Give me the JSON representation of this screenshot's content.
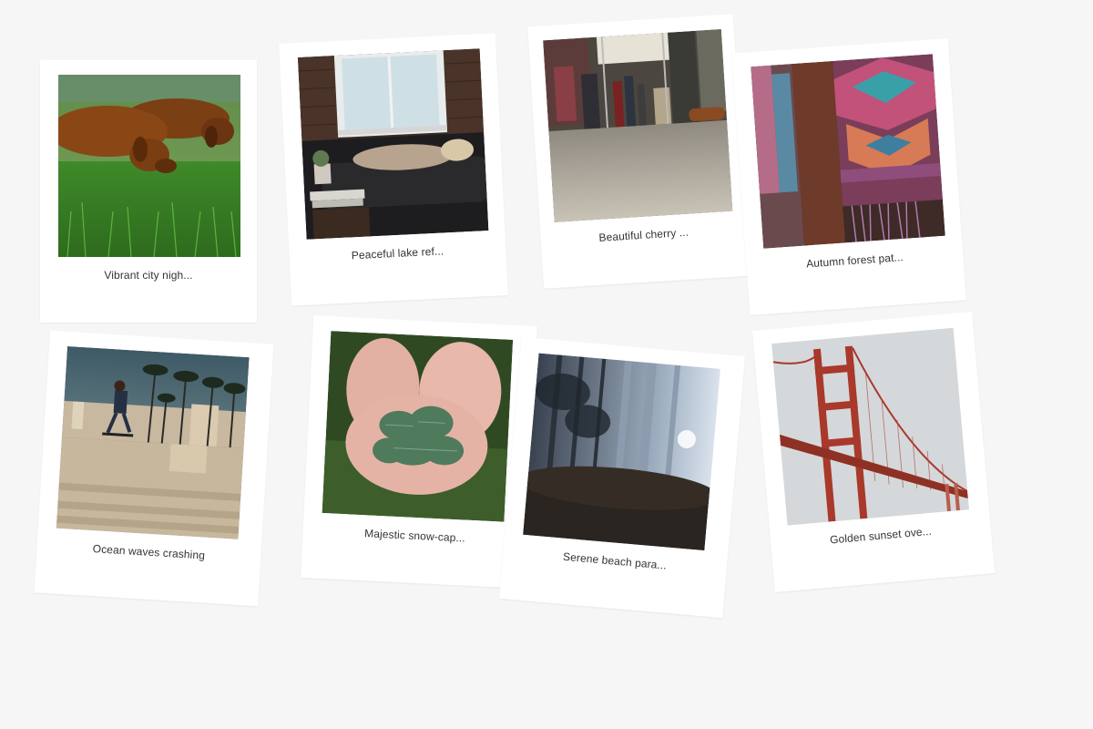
{
  "gallery": {
    "cards": [
      {
        "caption": "Vibrant city nigh...",
        "image": "dachshunds-on-grass"
      },
      {
        "caption": "Peaceful lake ref...",
        "image": "person-resting-on-sofa-by-window"
      },
      {
        "caption": "Beautiful cherry ...",
        "image": "subway-car-floor"
      },
      {
        "caption": "Autumn forest pat...",
        "image": "colorful-knit-shawl"
      },
      {
        "caption": "Ocean waves crashing",
        "image": "skateboarder-with-palm-trees"
      },
      {
        "caption": "Majestic snow-cap...",
        "image": "hands-holding-pine-sprigs"
      },
      {
        "caption": "Serene beach para...",
        "image": "misty-forest"
      },
      {
        "caption": "Golden sunset ove...",
        "image": "golden-gate-bridge-in-fog"
      }
    ]
  }
}
